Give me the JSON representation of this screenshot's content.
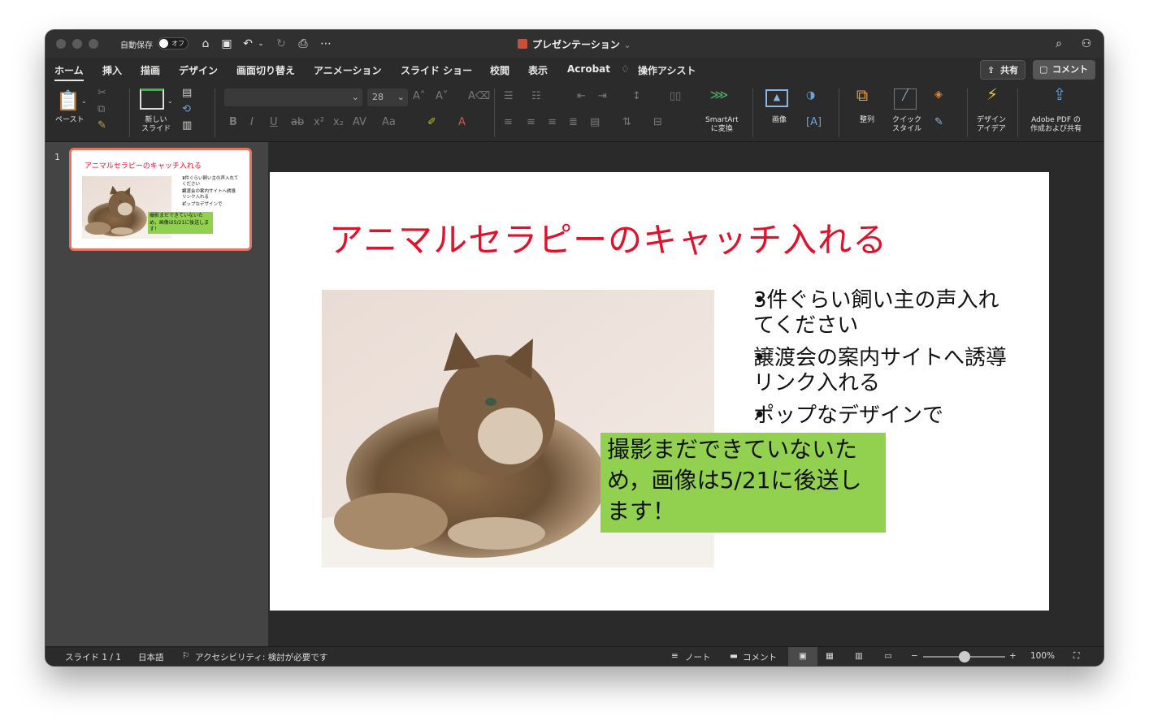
{
  "window": {
    "title": "プレゼンテーション",
    "autosave_label": "自動保存",
    "autosave_state": "オフ"
  },
  "tabs": [
    "ホーム",
    "挿入",
    "描画",
    "デザイン",
    "画面切り替え",
    "アニメーション",
    "スライド ショー",
    "校閲",
    "表示",
    "Acrobat",
    "操作アシスト"
  ],
  "top_buttons": {
    "share": "共有",
    "comment": "コメント"
  },
  "ribbon": {
    "paste": "ペースト",
    "new_slide": [
      "新しい",
      "スライド"
    ],
    "font_size": "28",
    "font_name": "",
    "smartart": [
      "SmartArt",
      "に変換"
    ],
    "picture": "画像",
    "arrange": "整列",
    "quick_style": [
      "クイック",
      "スタイル"
    ],
    "design_ideas": [
      "デザイン",
      "アイデア"
    ],
    "adobe_pdf": [
      "Adobe PDF の",
      "作成および共有"
    ]
  },
  "thumbnail": {
    "number": "1"
  },
  "slide": {
    "title": "アニマルセラピーのキャッチ入れる",
    "bullets": [
      "3件ぐらい飼い主の声入れてください",
      "譲渡会の案内サイトへ誘導リンク入れる",
      "ポップなデザインで"
    ],
    "note": "撮影まだできていないため，画像は5/21に後送します！"
  },
  "status": {
    "slide_counter": "スライド 1 / 1",
    "language": "日本語",
    "accessibility": "アクセシビリティ: 検討が必要です",
    "notes": "ノート",
    "comments": "コメント",
    "zoom": "100%",
    "zoom_level": 0.5
  },
  "colors": {
    "title_red": "#e0112b",
    "note_green": "#92d050",
    "thumb_border": "#e57362"
  }
}
